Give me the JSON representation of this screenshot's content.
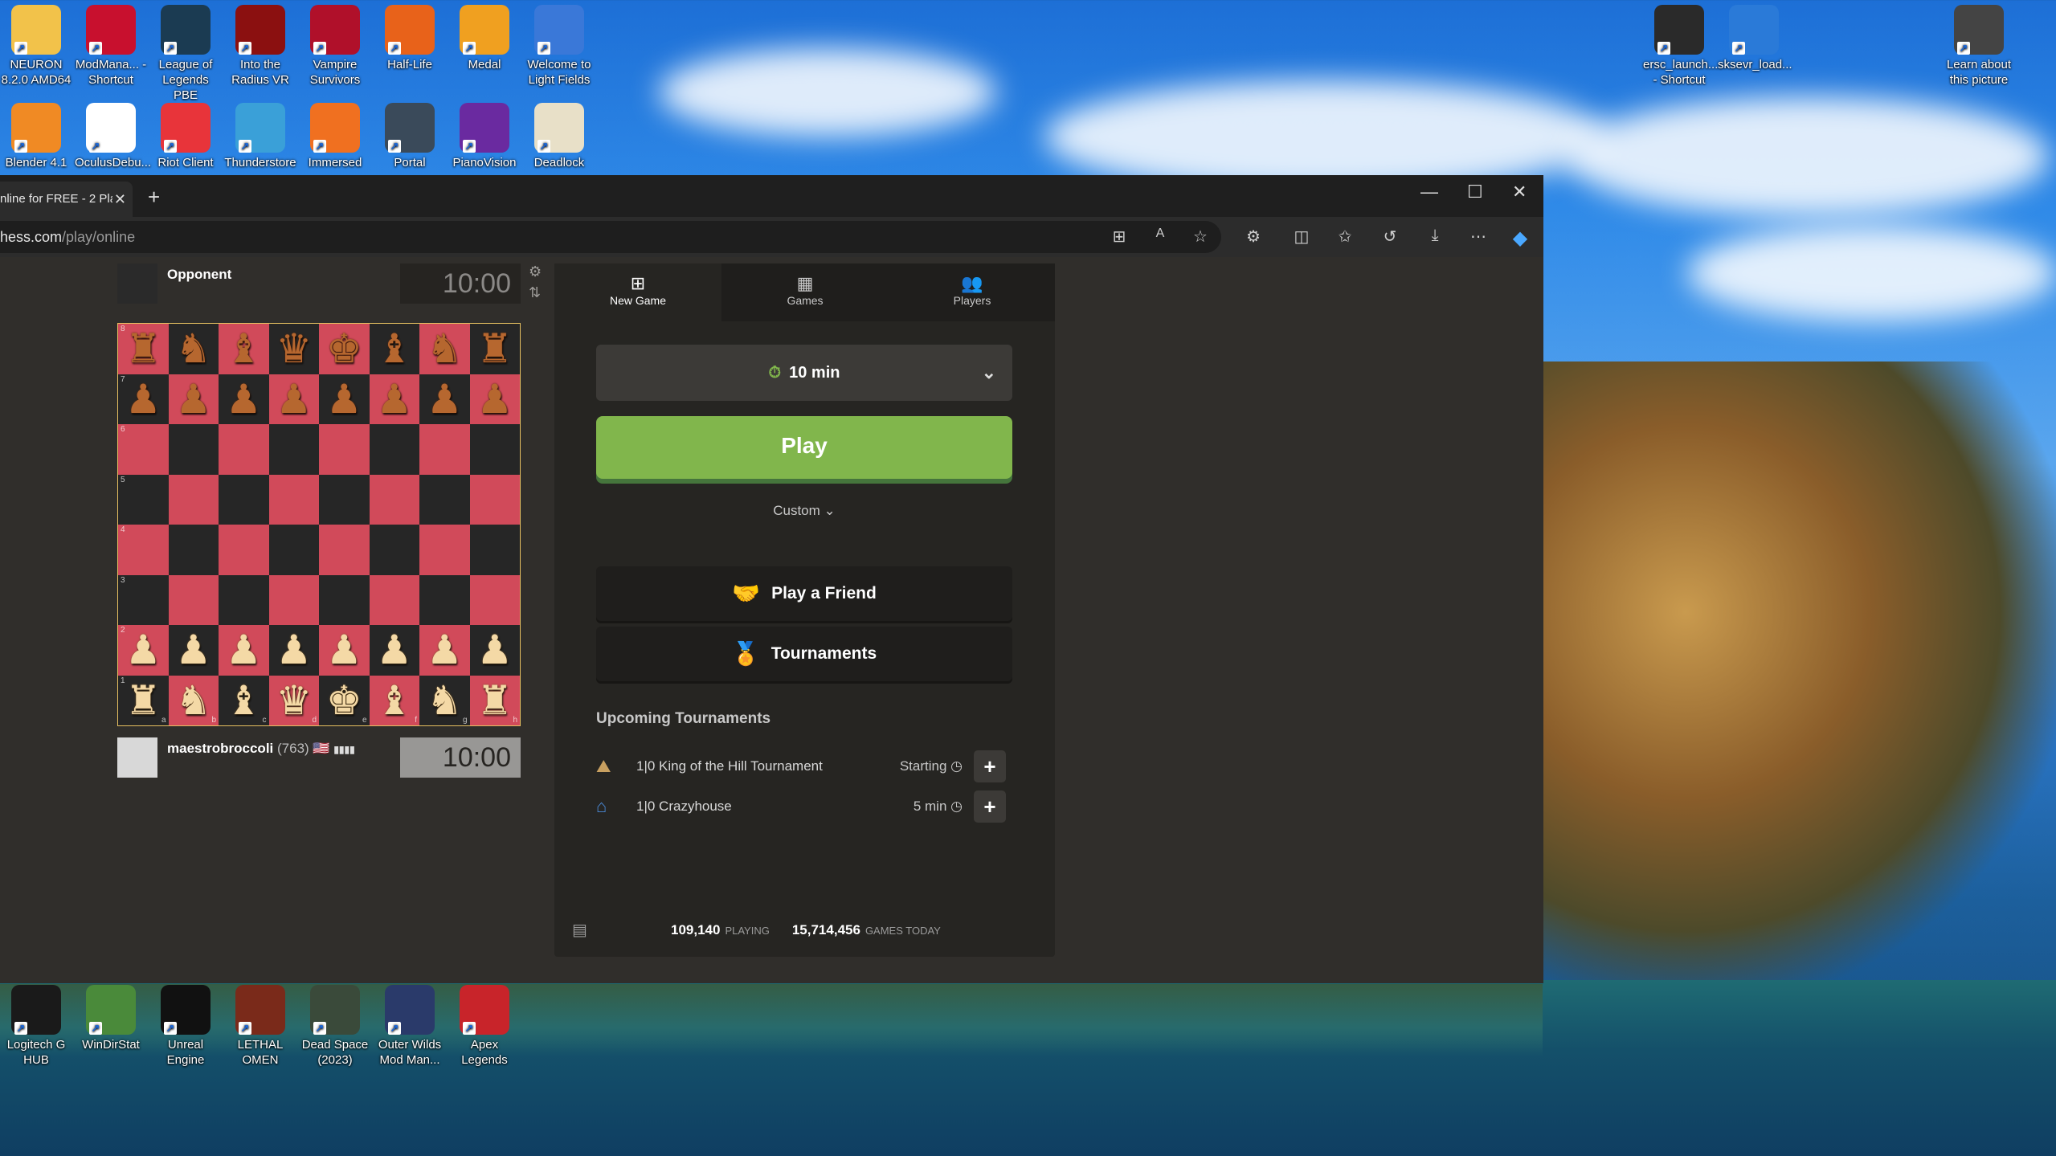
{
  "desktop": {
    "top_row": [
      {
        "label": "NEURON 8.2.0 AMD64",
        "icon": "folder-icon",
        "color": "#f2c24a"
      },
      {
        "label": "ModMana... - Shortcut",
        "icon": "modmanager-icon",
        "color": "#c8102e"
      },
      {
        "label": "League of Legends PBE",
        "icon": "league-icon",
        "color": "#1b3b52"
      },
      {
        "label": "Into the Radius VR",
        "icon": "radius-icon",
        "color": "#8b1010"
      },
      {
        "label": "Vampire Survivors",
        "icon": "vampire-icon",
        "color": "#b0102a"
      },
      {
        "label": "Half-Life",
        "icon": "halflife-icon",
        "color": "#e8621a"
      },
      {
        "label": "Medal",
        "icon": "medal-icon",
        "color": "#f0a020"
      },
      {
        "label": "Welcome to Light Fields",
        "icon": "lightfields-icon",
        "color": "#3a78d8"
      }
    ],
    "second_row": [
      {
        "label": "Blender 4.1",
        "icon": "blender-icon",
        "color": "#f08a24"
      },
      {
        "label": "OculusDebu...",
        "icon": "oculus-icon",
        "color": "#ffffff"
      },
      {
        "label": "Riot Client",
        "icon": "riot-icon",
        "color": "#e8343a"
      },
      {
        "label": "Thunderstore",
        "icon": "thunderstore-icon",
        "color": "#3aa0d8"
      },
      {
        "label": "Immersed",
        "icon": "immersed-icon",
        "color": "#f07020"
      },
      {
        "label": "Portal",
        "icon": "portal-icon",
        "color": "#3a4a5a"
      },
      {
        "label": "PianoVision",
        "icon": "pianovision-icon",
        "color": "#6a2aa0"
      },
      {
        "label": "Deadlock",
        "icon": "deadlock-icon",
        "color": "#e8e0c8"
      }
    ],
    "right_icons": [
      {
        "label": "ersc_launch... - Shortcut",
        "icon": "ersc-icon",
        "color": "#2a2a2a"
      },
      {
        "label": "sksevr_load...",
        "icon": "sksevr-icon",
        "color": "#2a7ad8"
      },
      {
        "label": "Learn about this picture",
        "icon": "camera-icon",
        "color": "#444444"
      }
    ],
    "bottom_row": [
      {
        "label": "Logitech G HUB",
        "icon": "logitech-icon",
        "color": "#1a1a1a"
      },
      {
        "label": "WinDirStat",
        "icon": "windirstat-icon",
        "color": "#4a8a3a"
      },
      {
        "label": "Unreal Engine",
        "icon": "unreal-icon",
        "color": "#111111"
      },
      {
        "label": "LETHAL OMEN",
        "icon": "lethal-omen-icon",
        "color": "#7a2a1a"
      },
      {
        "label": "Dead Space (2023)",
        "icon": "deadspace-icon",
        "color": "#3a4a3a"
      },
      {
        "label": "Outer Wilds Mod Man...",
        "icon": "outerwilds-icon",
        "color": "#2a3a6a"
      },
      {
        "label": "Apex Legends",
        "icon": "apex-icon",
        "color": "#c8242a"
      }
    ]
  },
  "browser": {
    "tab_title": "nline for FREE - 2 Pla",
    "url_host": "hess.com",
    "url_path": "/play/online"
  },
  "game": {
    "opponent_name": "Opponent",
    "opponent_clock": "10:00",
    "player_name": "maestrobroccoli",
    "player_rating": "(763)",
    "player_flag": "🇺🇸",
    "player_clock": "10:00",
    "board_colors": {
      "light": "#d14a5a",
      "dark": "#262626"
    }
  },
  "panel": {
    "tabs": [
      {
        "label": "New Game",
        "icon": "plus-icon"
      },
      {
        "label": "Games",
        "icon": "board-icon"
      },
      {
        "label": "Players",
        "icon": "players-icon"
      }
    ],
    "time_control": "10 min",
    "play_label": "Play",
    "custom_label": "Custom",
    "play_friend_label": "Play a Friend",
    "tournaments_label": "Tournaments",
    "upcoming_title": "Upcoming Tournaments",
    "tournaments": [
      {
        "name": "1|0 King of the Hill Tournament",
        "status": "Starting",
        "icon": "king-hill-icon"
      },
      {
        "name": "1|0 Crazyhouse",
        "status": "5 min",
        "icon": "crazyhouse-icon"
      }
    ],
    "playing_count": "109,140",
    "playing_label": "PLAYING",
    "games_today_count": "15,714,456",
    "games_today_label": "GAMES TODAY",
    "accent": "#81b64c"
  }
}
